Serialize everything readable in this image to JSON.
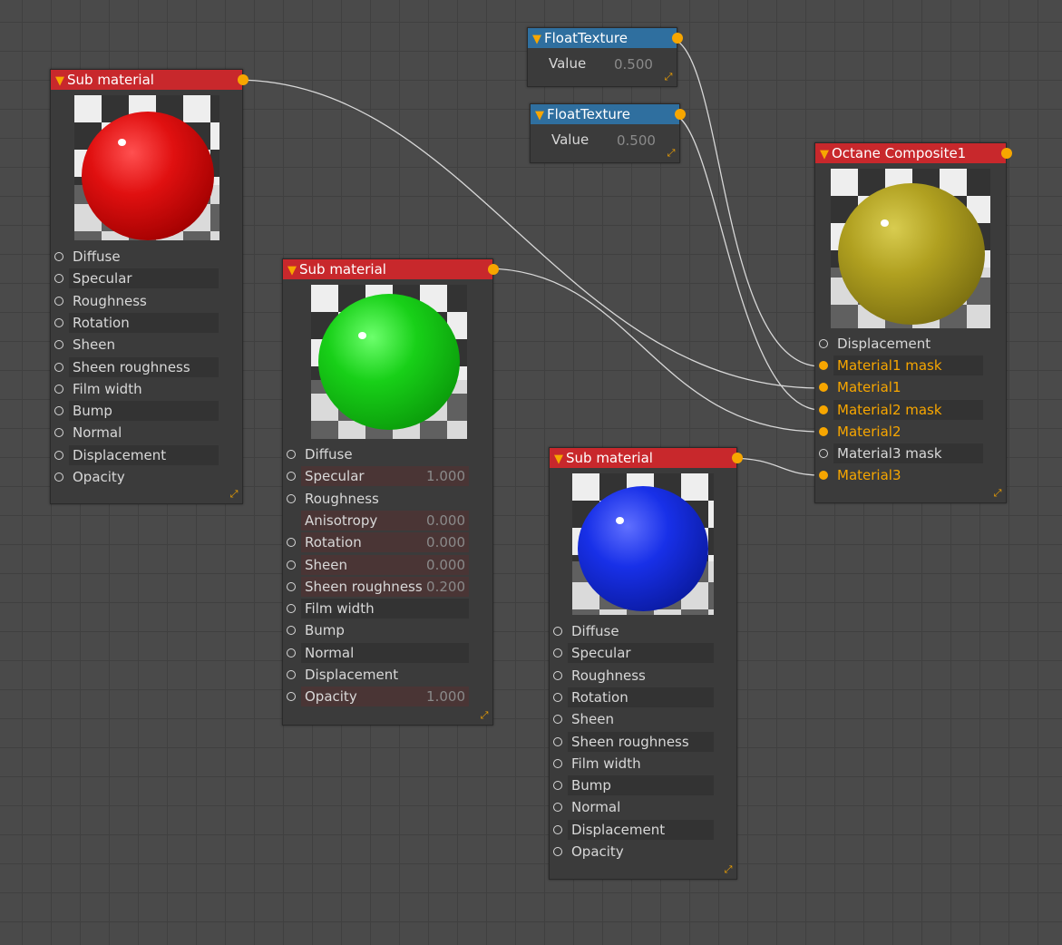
{
  "float_texture_1": {
    "title": "FloatTexture",
    "param_label": "Value",
    "param_value": "0.500"
  },
  "float_texture_2": {
    "title": "FloatTexture",
    "param_label": "Value",
    "param_value": "0.500"
  },
  "sub_material_red": {
    "title": "Sub material",
    "inputs": [
      "Diffuse",
      "Specular",
      "Roughness",
      "Rotation",
      "Sheen",
      "Sheen roughness",
      "Film width",
      "Bump",
      "Normal",
      "Displacement",
      "Opacity"
    ]
  },
  "sub_material_green": {
    "title": "Sub material",
    "inputs": [
      {
        "label": "Diffuse",
        "value": ""
      },
      {
        "label": "Specular",
        "value": "1.000"
      },
      {
        "label": "Roughness",
        "value": ""
      },
      {
        "label": "Anisotropy",
        "value": "0.000"
      },
      {
        "label": "Rotation",
        "value": "0.000"
      },
      {
        "label": "Sheen",
        "value": "0.000"
      },
      {
        "label": "Sheen roughness",
        "value": "0.200"
      },
      {
        "label": "Film width",
        "value": ""
      },
      {
        "label": "Bump",
        "value": ""
      },
      {
        "label": "Normal",
        "value": ""
      },
      {
        "label": "Displacement",
        "value": ""
      },
      {
        "label": "Opacity",
        "value": "1.000"
      }
    ]
  },
  "sub_material_blue": {
    "title": "Sub material",
    "inputs": [
      "Diffuse",
      "Specular",
      "Roughness",
      "Rotation",
      "Sheen",
      "Sheen roughness",
      "Film width",
      "Bump",
      "Normal",
      "Displacement",
      "Opacity"
    ]
  },
  "octane_composite": {
    "title": "Octane Composite1",
    "inputs": [
      "Displacement",
      "Material1 mask",
      "Material1",
      "Material2 mask",
      "Material2",
      "Material3 mask",
      "Material3"
    ]
  },
  "colors": {
    "header_red": "#c8282c",
    "header_blue": "#2f6f9f",
    "port_orange": "#f7a600",
    "sphere_red": "#e01010",
    "sphere_green": "#18d018",
    "sphere_blue": "#1830e8",
    "sphere_yellow": "#b0a020"
  }
}
